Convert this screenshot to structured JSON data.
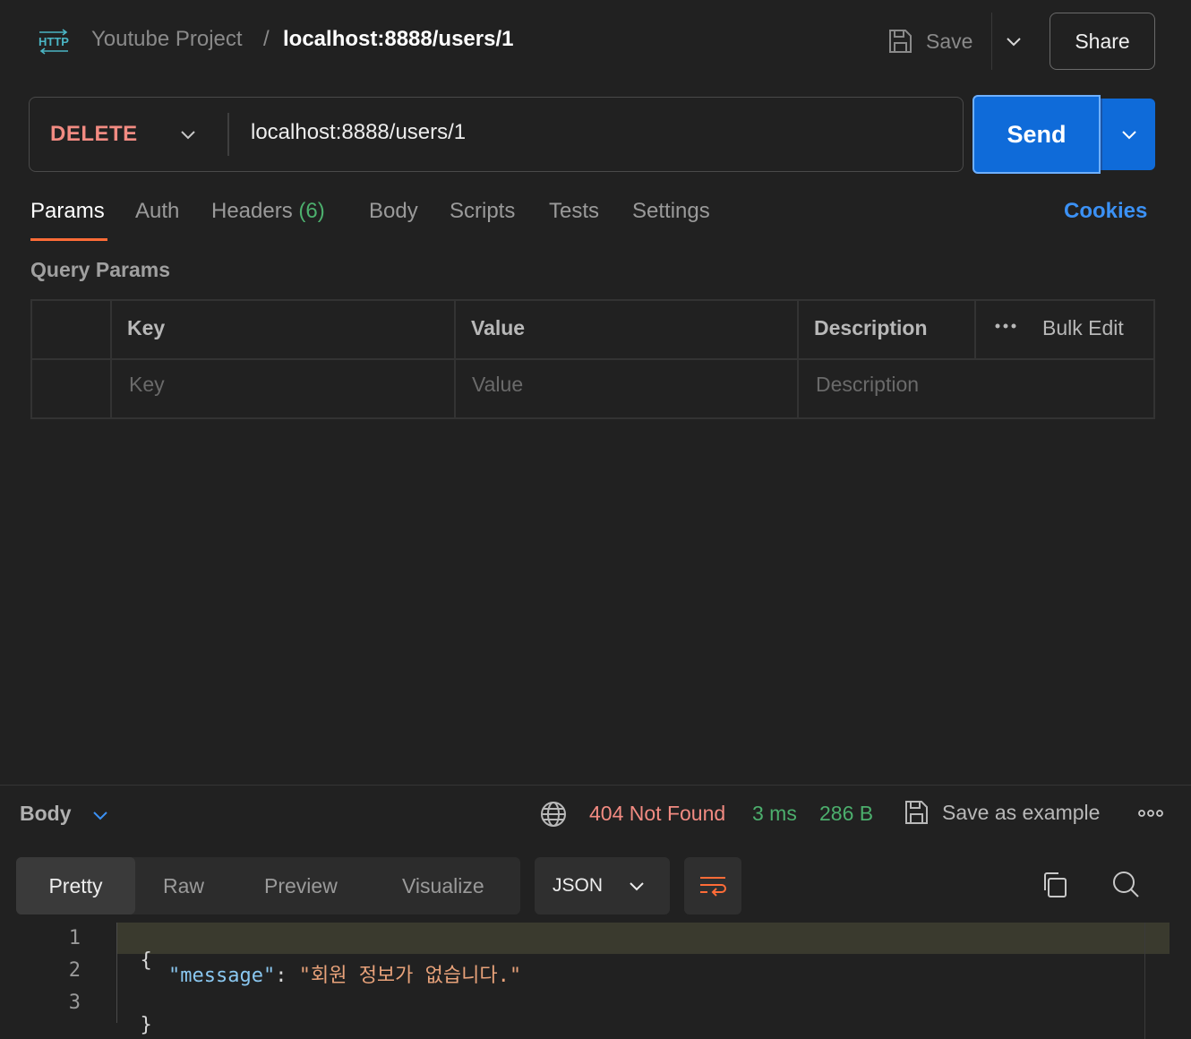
{
  "header": {
    "project": "Youtube Project",
    "separator": "/",
    "request_name": "localhost:8888/users/1",
    "save_label": "Save",
    "share_label": "Share"
  },
  "request": {
    "method": "DELETE",
    "url": "localhost:8888/users/1",
    "send_label": "Send"
  },
  "tabs": {
    "params": "Params",
    "auth": "Auth",
    "headers": "Headers",
    "headers_count": "(6)",
    "body": "Body",
    "scripts": "Scripts",
    "tests": "Tests",
    "settings": "Settings",
    "cookies": "Cookies",
    "active": "Params"
  },
  "query_params": {
    "title": "Query Params",
    "columns": {
      "key": "Key",
      "value": "Value",
      "description": "Description"
    },
    "bulk_edit": "Bulk Edit",
    "placeholders": {
      "key": "Key",
      "value": "Value",
      "description": "Description"
    }
  },
  "response": {
    "section_label": "Body",
    "status": "404 Not Found",
    "time": "3 ms",
    "size": "286 B",
    "save_example": "Save as example",
    "views": [
      "Pretty",
      "Raw",
      "Preview",
      "Visualize"
    ],
    "active_view": "Pretty",
    "format": "JSON",
    "code": {
      "line_numbers": [
        "1",
        "2",
        "3"
      ],
      "open_brace": "{",
      "key": "\"message\"",
      "colon": ": ",
      "value": "\"회원 정보가 없습니다.\"",
      "close_brace": "}"
    }
  },
  "colors": {
    "accent_orange": "#ff6c37",
    "primary_blue": "#0f6bd9",
    "method_red": "#f28b82",
    "success_green": "#4caf6d"
  }
}
